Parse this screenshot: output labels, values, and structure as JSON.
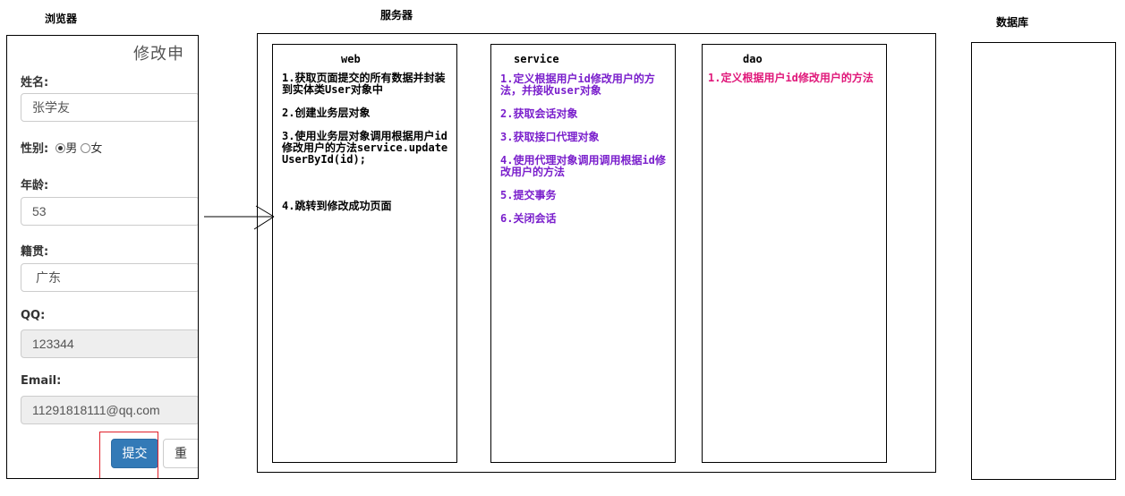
{
  "titles": {
    "browser": "浏览器",
    "server": "服务器",
    "database": "数据库"
  },
  "browser": {
    "heading": "修改申",
    "fields": {
      "name_label": "姓名:",
      "name_value": "张学友",
      "gender_label": "性别:",
      "gender_male": "男",
      "gender_female": "女",
      "age_label": "年龄:",
      "age_value": "53",
      "origin_label": "籍贯:",
      "origin_value": "广东",
      "qq_label": "QQ:",
      "qq_value": "123344",
      "email_label": "Email:",
      "email_value": "11291818111@qq.com"
    },
    "submit_label": "提交",
    "reset_label": "重"
  },
  "web": {
    "title": "web",
    "steps": [
      "1.获取页面提交的所有数据并封装到实体类User对象中",
      "2.创建业务层对象",
      "3.使用业务层对象调用根据用户id修改用户的方法service.updateUserById(id);",
      "4.跳转到修改成功页面"
    ]
  },
  "service": {
    "title": "service",
    "steps": [
      "1.定义根据用户id修改用户的方法，并接收user对象",
      "2.获取会话对象",
      "3.获取接口代理对象",
      "4.使用代理对象调用调用根据id修改用户的方法",
      "5.提交事务",
      "6.关闭会话"
    ]
  },
  "dao": {
    "title": "dao",
    "steps": [
      "1.定义根据用户id修改用户的方法"
    ]
  },
  "colors": {
    "web_text": "#000000",
    "service_text": "#7a1fcc",
    "dao_text": "#e0187a",
    "submit_button": "#337ab7",
    "highlight_border": "#e0202a"
  }
}
